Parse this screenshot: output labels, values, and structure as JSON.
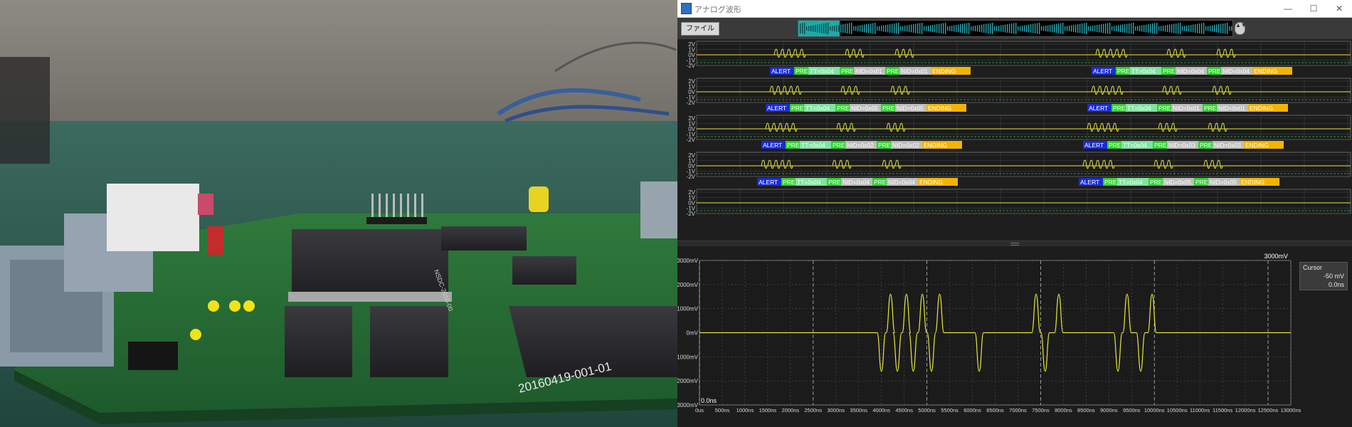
{
  "window": {
    "title": "アナログ波形",
    "min": "—",
    "max": "☐",
    "close": "✕"
  },
  "toolbar": {
    "file_label": "ファイル",
    "scroll_arrows": "▲▼"
  },
  "channels": {
    "y_ticks": [
      "2V",
      "1V",
      "0V",
      "-1V",
      "-2V"
    ],
    "rows": [
      {
        "left": [
          "ALERT",
          "PRE",
          "TT=0x04",
          "PRE",
          "NID=0x01",
          "PRE",
          "NID=0x01",
          "ENDING"
        ],
        "right": [
          "ALERT",
          "PRE",
          "TT=0x04",
          "PRE",
          "NID=0x04",
          "PRE",
          "NID=0x04",
          "ENDING"
        ]
      },
      {
        "left": [
          "ALERT",
          "PRE",
          "TT=0x04",
          "PRE",
          "NID=0x05",
          "PRE",
          "NID=0x05",
          "ENDING"
        ],
        "right": [
          "ALERT",
          "PRE",
          "TT=0x04",
          "PRE",
          "NID=0x01",
          "PRE",
          "NID=0x01",
          "ENDING"
        ]
      },
      {
        "left": [
          "ALERT",
          "PRE",
          "TT=0x04",
          "PRE",
          "NID=0x02",
          "PRE",
          "NID=0x02",
          "ENDING"
        ],
        "right": [
          "ALERT",
          "PRE",
          "TT=0x04",
          "PRE",
          "NID=0x03",
          "PRE",
          "NID=0x03",
          "ENDING"
        ]
      },
      {
        "left": [
          "ALERT",
          "PRE",
          "TT=0x04",
          "PRE",
          "NID=0x04",
          "PRE",
          "NID=0x04",
          "ENDING"
        ],
        "right": [
          "ALERT",
          "PRE",
          "TT=0x04",
          "PRE",
          "NID=0x05",
          "PRE",
          "NID=0x05",
          "ENDING"
        ]
      }
    ]
  },
  "scope": {
    "y_labels": [
      "3000mV",
      "2000mV",
      "1000mV",
      "0mV",
      "-1000mV",
      "-2000mV",
      "-3000mV"
    ],
    "x_labels": [
      "0us",
      "500ns",
      "1000ns",
      "1500ns",
      "2000ns",
      "2500ns",
      "3000ns",
      "3500ns",
      "4000ns",
      "4500ns",
      "5000ns",
      "5500ns",
      "6000ns",
      "6500ns",
      "7000ns",
      "7500ns",
      "8000ns",
      "8500ns",
      "9000ns",
      "9500ns",
      "10000ns",
      "10500ns",
      "11000ns",
      "11500ns",
      "12000ns",
      "12500ns",
      "13000ns"
    ],
    "top_right_label": "3000mV",
    "bottom_left_label": "0.0ns",
    "cursor": {
      "title": "Cursor",
      "value": "-50 mV",
      "time": "0.0ns"
    }
  },
  "photo": {
    "board_marking": "2016041​9-001-01",
    "chip_marking": "NSDC-2016-00"
  },
  "colors": {
    "trace": "#e6e83a",
    "alert": "#1a2bd8",
    "pre": "#2fd22f",
    "tt": "#7fe3a0",
    "nid": "#bdbdbd",
    "ending": "#f2b400",
    "grid": "#4a4a4a",
    "strip": "#22c8c8"
  }
}
